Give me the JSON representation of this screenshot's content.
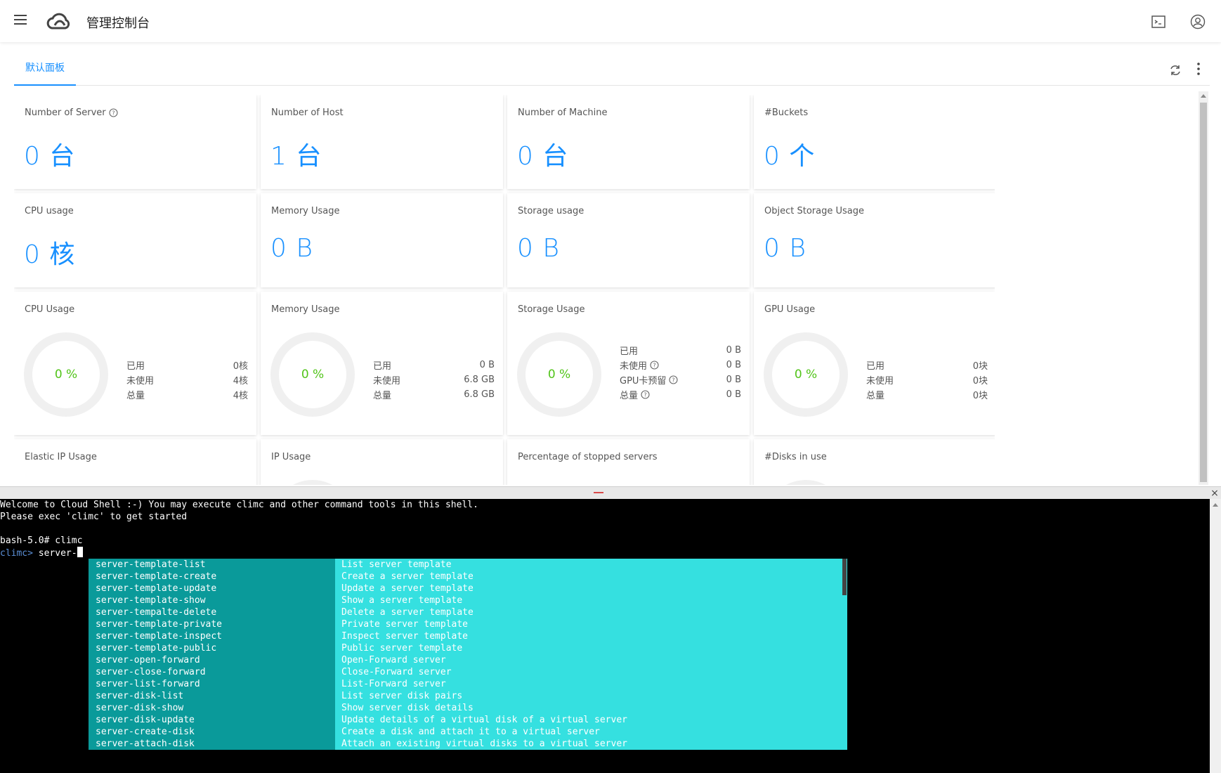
{
  "header": {
    "title": "管理控制台"
  },
  "tabs": [
    {
      "label": "默认面板"
    }
  ],
  "cards": {
    "server": {
      "title": "Number of Server",
      "value": "0 台"
    },
    "host": {
      "title": "Number of Host",
      "value": "1 台"
    },
    "machine": {
      "title": "Number of Machine",
      "value": "0 台"
    },
    "buckets": {
      "title": "#Buckets",
      "value": "0 个"
    },
    "cpu_usage": {
      "title": "CPU usage",
      "value": "0 核"
    },
    "memory_usage": {
      "title": "Memory Usage",
      "value": "0 B"
    },
    "storage_usage": {
      "title": "Storage usage",
      "value": "0 B"
    },
    "object_storage": {
      "title": "Object Storage Usage",
      "value": "0 B"
    },
    "cpu_ring": {
      "title": "CPU Usage",
      "percent": "0 %",
      "rows": [
        {
          "label": "已用",
          "value": "0核"
        },
        {
          "label": "未使用",
          "value": "4核"
        },
        {
          "label": "总量",
          "value": "4核"
        }
      ]
    },
    "mem_ring": {
      "title": "Memory Usage",
      "percent": "0 %",
      "rows": [
        {
          "label": "已用",
          "value": "0 B"
        },
        {
          "label": "未使用",
          "value": "6.8 GB"
        },
        {
          "label": "总量",
          "value": "6.8 GB"
        }
      ]
    },
    "storage_ring": {
      "title": "Storage Usage",
      "percent": "0 %",
      "rows": [
        {
          "label": "已用",
          "value": "0 B"
        },
        {
          "label": "未使用",
          "value": "0 B"
        },
        {
          "label": "GPU卡预留",
          "value": "0 B"
        },
        {
          "label": "总量",
          "value": "0 B"
        }
      ]
    },
    "gpu_ring": {
      "title": "GPU Usage",
      "percent": "0 %",
      "rows": [
        {
          "label": "已用",
          "value": "0块"
        },
        {
          "label": "未使用",
          "value": "0块"
        },
        {
          "label": "总量",
          "value": "0块"
        }
      ]
    },
    "elastic_ip": {
      "title": "Elastic IP Usage"
    },
    "ip_usage": {
      "title": "IP Usage"
    },
    "stopped": {
      "title": "Percentage of stopped servers"
    },
    "disks": {
      "title": "#Disks in use"
    }
  },
  "terminal": {
    "welcome": "Welcome to Cloud Shell :-) You may execute climc and other command tools in this shell.",
    "hint": "Please exec 'climc' to get started",
    "bash_prompt": "bash-5.0# climc",
    "climc_prompt": "climc>",
    "input": " server-"
  },
  "completions": [
    {
      "cmd": "server-template-list",
      "desc": "List server template"
    },
    {
      "cmd": "server-template-create",
      "desc": "Create a server template"
    },
    {
      "cmd": "server-template-update",
      "desc": "Update a server template"
    },
    {
      "cmd": "server-template-show",
      "desc": "Show a server template"
    },
    {
      "cmd": "server-tempalte-delete",
      "desc": "Delete a server template"
    },
    {
      "cmd": "server-template-private",
      "desc": "Private server template"
    },
    {
      "cmd": "server-template-inspect",
      "desc": "Inspect server template"
    },
    {
      "cmd": "server-template-public",
      "desc": "Public server template"
    },
    {
      "cmd": "server-open-forward",
      "desc": "Open-Forward server"
    },
    {
      "cmd": "server-close-forward",
      "desc": "Close-Forward server"
    },
    {
      "cmd": "server-list-forward",
      "desc": "List-Forward server"
    },
    {
      "cmd": "server-disk-list",
      "desc": "List server disk pairs"
    },
    {
      "cmd": "server-disk-show",
      "desc": "Show server disk details"
    },
    {
      "cmd": "server-disk-update",
      "desc": "Update details of a virtual disk of a virtual server"
    },
    {
      "cmd": "server-create-disk",
      "desc": "Create a disk and attach it to a virtual server"
    },
    {
      "cmd": "server-attach-disk",
      "desc": "Attach an existing virtual disks to a virtual server"
    }
  ],
  "colors": {
    "accent": "#1890ff",
    "percent": "#52c41a",
    "popup_left": "#0a9a9a",
    "popup_right": "#35e0e0"
  }
}
